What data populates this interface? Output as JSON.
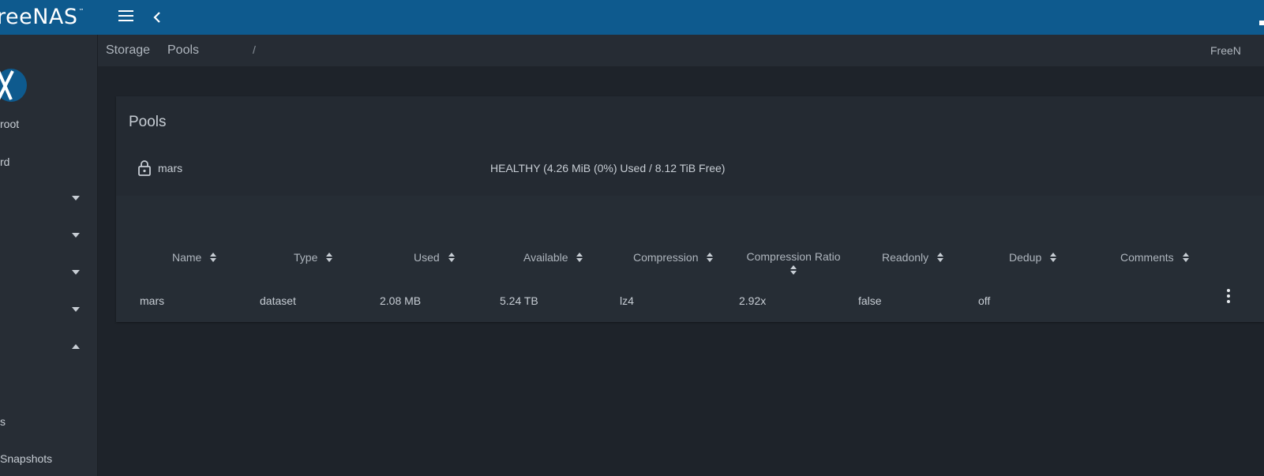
{
  "app": {
    "brand": "FreeNAS",
    "brand_visible": "reeNAS",
    "trademark": "™"
  },
  "topbar": {
    "menu_icon": "hamburger-menu-icon",
    "back_icon": "chevron-left-icon"
  },
  "sidebar": {
    "logo": "freenas-x-logo",
    "user": "root",
    "items": [
      {
        "label": "rd",
        "icon": ""
      },
      {
        "label": "",
        "expand_icon": "caret-down-icon"
      },
      {
        "label": "",
        "expand_icon": "caret-down-icon"
      },
      {
        "label": "",
        "expand_icon": "caret-down-icon"
      },
      {
        "label": "",
        "expand_icon": "caret-down-icon"
      },
      {
        "label": "",
        "expand_icon": "caret-up-icon"
      },
      {
        "label": "s"
      },
      {
        "label": "Snapshots"
      }
    ]
  },
  "breadcrumb": {
    "items": [
      "Storage",
      "Pools"
    ],
    "separator": "/",
    "right": "FreeN"
  },
  "pools_card": {
    "title": "Pools",
    "pool": {
      "name": "mars",
      "icon": "lock-icon",
      "status": "HEALTHY (4.26 MiB (0%) Used / 8.12 TiB Free)"
    },
    "table": {
      "columns": [
        "Name",
        "Type",
        "Used",
        "Available",
        "Compression",
        "Compression Ratio",
        "Readonly",
        "Dedup",
        "Comments"
      ],
      "rows": [
        {
          "name": "mars",
          "type": "dataset",
          "used": "2.08 MB",
          "available": "5.24 TB",
          "compression": "lz4",
          "ratio": "2.92x",
          "readonly": "false",
          "dedup": "off",
          "comments": ""
        }
      ],
      "row_menu_icon": "more-vert-icon"
    }
  },
  "colors": {
    "topbar": "#0e5a8e",
    "background": "#1e232a",
    "sidebar": "#272d35",
    "card": "#242a32",
    "logo": "#0e5a8e"
  }
}
